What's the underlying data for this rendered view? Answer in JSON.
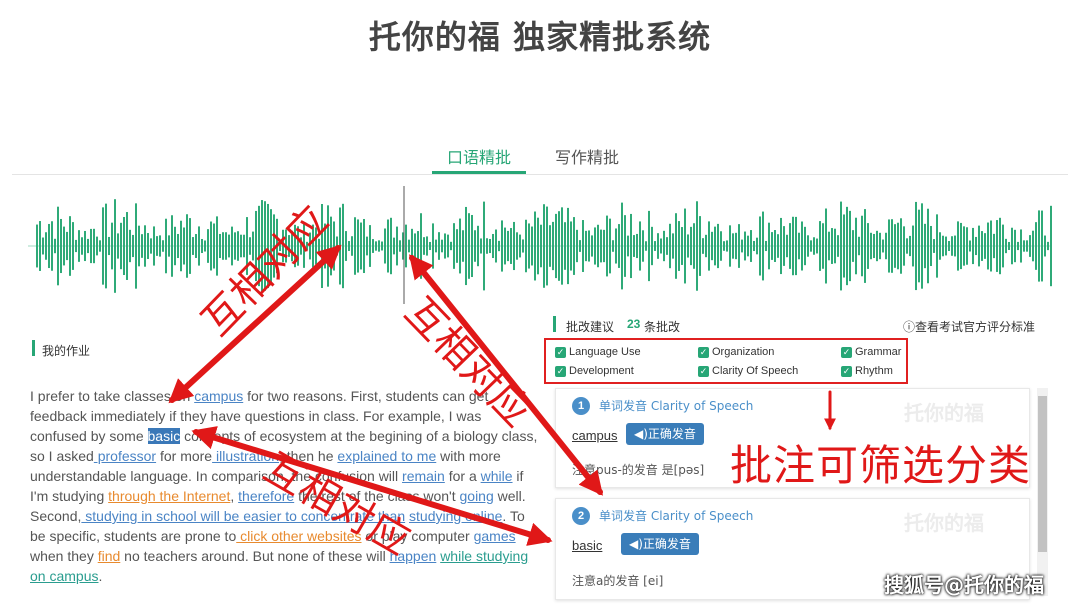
{
  "title": "托你的福 独家精批系统",
  "tabs": {
    "oral": "口语精批",
    "writing": "写作精批"
  },
  "homework": {
    "title": "我的作业",
    "essay": {
      "s1": "I prefer to take classes on ",
      "w_campus": "campus",
      "s2": " for two reasons. First, students can get feedback immediately if they have questions in class. For example, I was confused by some ",
      "w_basic": "basic",
      "s3": " concepts of ecosystem at the begining of a biology class, so I asked",
      "w_professor": " professor",
      "s4": " for more",
      "w_illustration": " illustration",
      "s5": ", then he ",
      "w_explained": "explained to me",
      "s6": " with more understandable language. In comparison, the confusion will ",
      "w_remain": "remain",
      "s7": " for a ",
      "w_while": "while",
      "s8": " if I'm studying ",
      "w_internet": "through the Internet",
      "s9": ", ",
      "w_therefore": "therefore",
      "s10": " the rest of the class won't ",
      "w_going": "going",
      "s11": " well. Second,",
      "w_studying_school": " studying in school will be easier to concentrate than",
      "s12": " ",
      "w_studying_online": "studying online",
      "s13": ". To be specific, students are prone to",
      "w_click": " click other websites",
      "s14": " or play computer ",
      "w_games": "games",
      "s15": " when they ",
      "w_find": "find",
      "s16": " no teachers around. But none of these will ",
      "w_happen": "happen",
      "s17": " ",
      "w_while_campus": "while studying on campus",
      "s18": "."
    }
  },
  "review": {
    "title": "批改建议",
    "count": "23",
    "count_suffix": "条批改",
    "standard_link": "ⓘ查看考试官方评分标准",
    "filters": [
      "Language Use",
      "Organization",
      "Grammar",
      "Development",
      "Clarity Of Speech",
      "Rhythm"
    ],
    "cards": [
      {
        "num": "1",
        "type": "单词发音 Clarity of Speech",
        "word": "campus",
        "button": "◀)正确发音",
        "note": "注意pus-的发音 是[pəs]",
        "wm": "托你的福"
      },
      {
        "num": "2",
        "type": "单词发音 Clarity of Speech",
        "word": "basic",
        "button": "◀)正确发音",
        "note": "注意a的发音 [ei]",
        "wm": "托你的福"
      }
    ]
  },
  "annotations": {
    "mutual": "互相对应",
    "filter_caption": "批注可筛选分类",
    "color": "#e01818"
  },
  "watermark": "搜狐号@托你的福",
  "colors": {
    "accent": "#27a676",
    "blue": "#4a84c5",
    "orange": "#e88a2e",
    "button": "#3a7db9"
  }
}
